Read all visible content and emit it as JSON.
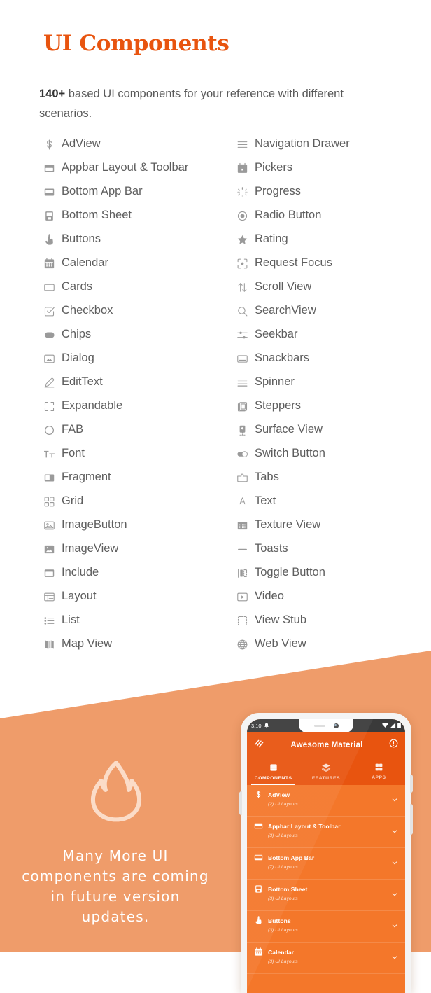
{
  "header": {
    "title": "UI Components",
    "title_color": "#E8540F",
    "intro_bold": "140+",
    "intro_rest": " based UI components for your reference with different scenarios."
  },
  "components": {
    "left_column": [
      {
        "icon": "dollar-icon",
        "label": "AdView"
      },
      {
        "icon": "appbar-icon",
        "label": "Appbar Layout & Toolbar"
      },
      {
        "icon": "bottom-app-bar-icon",
        "label": "Bottom App Bar"
      },
      {
        "icon": "bottom-sheet-icon",
        "label": "Bottom Sheet"
      },
      {
        "icon": "tap-icon",
        "label": "Buttons"
      },
      {
        "icon": "calendar-icon",
        "label": "Calendar"
      },
      {
        "icon": "card-icon",
        "label": "Cards"
      },
      {
        "icon": "checkbox-icon",
        "label": "Checkbox"
      },
      {
        "icon": "chip-icon",
        "label": "Chips"
      },
      {
        "icon": "dialog-icon",
        "label": "Dialog"
      },
      {
        "icon": "pencil-icon",
        "label": "EditText"
      },
      {
        "icon": "expand-icon",
        "label": "Expandable"
      },
      {
        "icon": "circle-icon",
        "label": "FAB"
      },
      {
        "icon": "font-size-icon",
        "label": "Font"
      },
      {
        "icon": "fragment-icon",
        "label": "Fragment"
      },
      {
        "icon": "grid-icon",
        "label": "Grid"
      },
      {
        "icon": "image-button-icon",
        "label": "ImageButton"
      },
      {
        "icon": "image-icon",
        "label": "ImageView"
      },
      {
        "icon": "include-icon",
        "label": "Include"
      },
      {
        "icon": "layout-icon",
        "label": "Layout"
      },
      {
        "icon": "list-icon",
        "label": "List"
      },
      {
        "icon": "map-icon",
        "label": "Map View"
      }
    ],
    "right_column": [
      {
        "icon": "hamburger-icon",
        "label": "Navigation Drawer"
      },
      {
        "icon": "date-picker-icon",
        "label": "Pickers"
      },
      {
        "icon": "spinner-progress-icon",
        "label": "Progress"
      },
      {
        "icon": "radio-button-icon",
        "label": "Radio Button"
      },
      {
        "icon": "star-icon",
        "label": "Rating"
      },
      {
        "icon": "focus-icon",
        "label": "Request Focus"
      },
      {
        "icon": "scroll-icon",
        "label": "Scroll View"
      },
      {
        "icon": "search-icon",
        "label": "SearchView"
      },
      {
        "icon": "sliders-icon",
        "label": "Seekbar"
      },
      {
        "icon": "snackbar-icon",
        "label": "Snackbars"
      },
      {
        "icon": "spinner-list-icon",
        "label": "Spinner"
      },
      {
        "icon": "steppers-icon",
        "label": "Steppers"
      },
      {
        "icon": "surface-view-icon",
        "label": "Surface View"
      },
      {
        "icon": "switch-icon",
        "label": "Switch Button"
      },
      {
        "icon": "tabs-icon",
        "label": "Tabs"
      },
      {
        "icon": "text-icon",
        "label": "Text"
      },
      {
        "icon": "texture-icon",
        "label": "Texture View"
      },
      {
        "icon": "toast-icon",
        "label": "Toasts"
      },
      {
        "icon": "toggle-icon",
        "label": "Toggle Button"
      },
      {
        "icon": "video-icon",
        "label": "Video"
      },
      {
        "icon": "view-stub-icon",
        "label": "View Stub"
      },
      {
        "icon": "globe-icon",
        "label": "Web View"
      }
    ]
  },
  "promo": {
    "band_color": "#EF9C6A",
    "icon": "flame-icon",
    "line1": "Many More UI",
    "line2": "components are coming",
    "line3": "in future version",
    "line4": "updates."
  },
  "phone": {
    "status": {
      "time": "3:10",
      "left_icon": "notification-bell-icon",
      "right_icons": [
        "wifi-icon",
        "signal-icon",
        "battery-icon"
      ]
    },
    "app_bar": {
      "menu_icon": "app-logo-icon",
      "title": "Awesome Material",
      "action_icon": "info-icon"
    },
    "tabs": [
      {
        "icon": "components-icon",
        "label": "COMPONENTS",
        "active": true
      },
      {
        "icon": "layers-icon",
        "label": "FEATURES",
        "active": false
      },
      {
        "icon": "apps-grid-icon",
        "label": "APPS",
        "active": false
      }
    ],
    "list": [
      {
        "icon": "dollar-icon",
        "title": "AdView",
        "subtitle": "(2) UI Layouts",
        "chevron": "chevron-down-icon"
      },
      {
        "icon": "appbar-icon",
        "title": "Appbar Layout & Toolbar",
        "subtitle": "(3) UI Layouts",
        "chevron": "chevron-down-icon"
      },
      {
        "icon": "bottom-app-bar-icon",
        "title": "Bottom App Bar",
        "subtitle": "(7) UI Layouts",
        "chevron": "chevron-down-icon"
      },
      {
        "icon": "bottom-sheet-icon",
        "title": "Bottom Sheet",
        "subtitle": "(3) UI Layouts",
        "chevron": "chevron-down-icon"
      },
      {
        "icon": "tap-icon",
        "title": "Buttons",
        "subtitle": "(3) UI Layouts",
        "chevron": "chevron-down-icon"
      },
      {
        "icon": "calendar-icon",
        "title": "Calendar",
        "subtitle": "(3) UI Layouts",
        "chevron": "chevron-down-icon"
      }
    ],
    "colors": {
      "app_bar": "#E8540F",
      "list": "#F4772A"
    }
  }
}
